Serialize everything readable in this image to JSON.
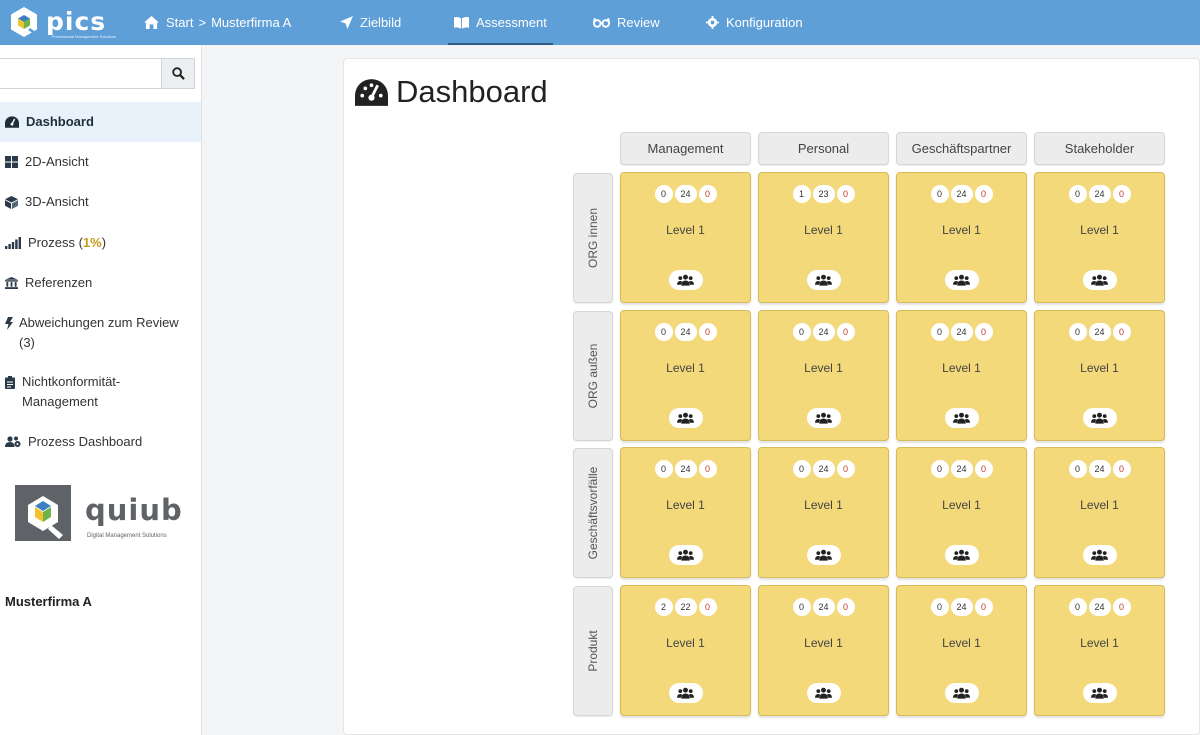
{
  "app": {
    "logo_text": "pics",
    "logo_tagline": "Professional Management Solutions"
  },
  "nav": {
    "breadcrumb_start": "Start",
    "breadcrumb_sep": ">",
    "breadcrumb_company": "Musterfirma A",
    "items": [
      {
        "label": "Zielbild",
        "icon": "paper-plane-icon"
      },
      {
        "label": "Assessment",
        "icon": "book-icon",
        "active": true
      },
      {
        "label": "Review",
        "icon": "glasses-icon"
      },
      {
        "label": "Konfiguration",
        "icon": "gear-icon"
      }
    ]
  },
  "sidebar": {
    "search_placeholder": "",
    "items": [
      {
        "label": "Dashboard",
        "icon": "tachometer-icon",
        "active": true
      },
      {
        "label": "2D-Ansicht",
        "icon": "grid-icon"
      },
      {
        "label": "3D-Ansicht",
        "icon": "cube-icon"
      },
      {
        "label": "Prozess (",
        "pct": "1%",
        "suffix": ")",
        "icon": "signal-icon"
      },
      {
        "label": "Referenzen",
        "icon": "bank-icon"
      },
      {
        "label": "Abweichungen zum Review (3)",
        "icon": "bolt-icon"
      },
      {
        "label": "Nichtkonformität-Management",
        "icon": "clipboard-icon"
      },
      {
        "label": "Prozess Dashboard",
        "icon": "users-cog-icon"
      }
    ],
    "partner_logo": {
      "name": "quiub",
      "tagline": "Digital Management Solutions"
    },
    "company": "Musterfirma A"
  },
  "main": {
    "title": "Dashboard",
    "columns": [
      "Management",
      "Personal",
      "Geschäftspartner",
      "Stakeholder"
    ],
    "rows": [
      {
        "label": "ORG innen",
        "cells": [
          {
            "a": "0",
            "b": "24",
            "c": "0",
            "level": "Level 1"
          },
          {
            "a": "1",
            "b": "23",
            "c": "0",
            "level": "Level 1"
          },
          {
            "a": "0",
            "b": "24",
            "c": "0",
            "level": "Level 1"
          },
          {
            "a": "0",
            "b": "24",
            "c": "0",
            "level": "Level 1"
          }
        ]
      },
      {
        "label": "ORG außen",
        "cells": [
          {
            "a": "0",
            "b": "24",
            "c": "0",
            "level": "Level 1"
          },
          {
            "a": "0",
            "b": "24",
            "c": "0",
            "level": "Level 1"
          },
          {
            "a": "0",
            "b": "24",
            "c": "0",
            "level": "Level 1"
          },
          {
            "a": "0",
            "b": "24",
            "c": "0",
            "level": "Level 1"
          }
        ]
      },
      {
        "label": "Geschäftsvorfälle",
        "cells": [
          {
            "a": "0",
            "b": "24",
            "c": "0",
            "level": "Level 1"
          },
          {
            "a": "0",
            "b": "24",
            "c": "0",
            "level": "Level 1"
          },
          {
            "a": "0",
            "b": "24",
            "c": "0",
            "level": "Level 1"
          },
          {
            "a": "0",
            "b": "24",
            "c": "0",
            "level": "Level 1"
          }
        ]
      },
      {
        "label": "Produkt",
        "cells": [
          {
            "a": "2",
            "b": "22",
            "c": "0",
            "level": "Level 1"
          },
          {
            "a": "0",
            "b": "24",
            "c": "0",
            "level": "Level 1"
          },
          {
            "a": "0",
            "b": "24",
            "c": "0",
            "level": "Level 1"
          },
          {
            "a": "0",
            "b": "24",
            "c": "0",
            "level": "Level 1"
          }
        ]
      }
    ]
  },
  "colors": {
    "nav": "#5e9fd8",
    "cell": "#f3d97a",
    "red": "#c0392b",
    "active_bg": "#e9f2fb"
  }
}
